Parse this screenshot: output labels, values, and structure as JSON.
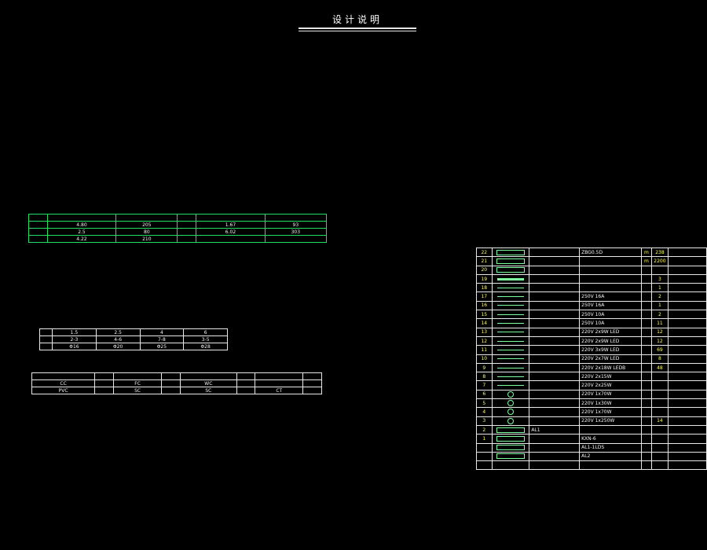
{
  "title": "设计说明",
  "left_column": [
    {
      "t": "",
      "s": "hd"
    },
    {
      "t": "",
      "s": ""
    },
    {
      "t": "",
      "s": ""
    },
    {
      "t": "",
      "s": "hd"
    },
    {
      "t": "",
      "s": ""
    },
    {
      "t": "",
      "s": ""
    },
    {
      "t": "",
      "s": ""
    },
    {
      "t": "",
      "s": ""
    },
    {
      "t": "",
      "s": "hd"
    },
    {
      "t": "",
      "s": ""
    },
    {
      "t": "",
      "s": ""
    },
    {
      "t": "",
      "s": ""
    },
    {
      "t": "",
      "s": ""
    },
    {
      "t": "",
      "s": ""
    },
    {
      "t": "",
      "s": ""
    },
    {
      "t": "",
      "s": "g"
    },
    {
      "t": "",
      "s": ""
    },
    {
      "t": "",
      "s": ""
    },
    {
      "t": "",
      "s": ""
    },
    {
      "t": "",
      "s": ""
    },
    {
      "t": "",
      "s": ""
    },
    {
      "t": "",
      "s": ""
    },
    {
      "t": "",
      "s": ""
    },
    {
      "t": "",
      "s": ""
    },
    {
      "t": "",
      "s": ""
    }
  ],
  "left_column_b": [
    {
      "t": "",
      "s": ""
    },
    {
      "t": "",
      "s": ""
    },
    {
      "t": "",
      "s": ""
    },
    {
      "t": "",
      "s": ""
    },
    {
      "t": "",
      "s": ""
    },
    {
      "t": "",
      "s": ""
    },
    {
      "t": "",
      "s": ""
    },
    {
      "t": "",
      "s": ""
    },
    {
      "t": "",
      "s": ""
    },
    {
      "t": "",
      "s": ""
    }
  ],
  "left_column_c": [
    {
      "t": "",
      "s": "g"
    },
    {
      "t": "",
      "s": ""
    }
  ],
  "left_column_d": [
    {
      "t": "",
      "s": ""
    },
    {
      "t": "",
      "s": ""
    },
    {
      "t": "",
      "s": ""
    },
    {
      "t": "",
      "s": ""
    },
    {
      "t": "",
      "s": ""
    },
    {
      "t": "",
      "s": "hd"
    },
    {
      "t": "",
      "s": ""
    },
    {
      "t": "",
      "s": ""
    },
    {
      "t": "",
      "s": ""
    },
    {
      "t": "",
      "s": ""
    },
    {
      "t": "",
      "s": ""
    },
    {
      "t": "",
      "s": ""
    },
    {
      "t": "",
      "s": ""
    },
    {
      "t": "",
      "s": ""
    },
    {
      "t": "",
      "s": ""
    }
  ],
  "right_column": [
    {
      "t": "",
      "s": ""
    },
    {
      "t": "",
      "s": ""
    },
    {
      "t": "",
      "s": ""
    },
    {
      "t": "",
      "s": ""
    },
    {
      "t": "",
      "s": ""
    },
    {
      "t": "",
      "s": ""
    },
    {
      "t": "",
      "s": ""
    },
    {
      "t": "",
      "s": ""
    },
    {
      "t": "",
      "s": ""
    },
    {
      "t": "",
      "s": ""
    },
    {
      "t": "",
      "s": ""
    },
    {
      "t": "",
      "s": ""
    },
    {
      "t": "",
      "s": ""
    },
    {
      "t": "",
      "s": ""
    },
    {
      "t": "",
      "s": ""
    },
    {
      "t": "",
      "s": ""
    },
    {
      "t": "",
      "s": ""
    },
    {
      "t": "",
      "s": ""
    },
    {
      "t": "",
      "s": ""
    },
    {
      "t": "",
      "s": ""
    },
    {
      "t": "",
      "s": ""
    },
    {
      "t": "",
      "s": ""
    },
    {
      "t": "",
      "s": ""
    },
    {
      "t": "",
      "s": ""
    },
    {
      "t": "",
      "s": ""
    },
    {
      "t": "",
      "s": ""
    },
    {
      "t": "",
      "s": ""
    },
    {
      "t": "",
      "s": ""
    },
    {
      "t": "",
      "s": ""
    }
  ],
  "illum_table": {
    "headers": [
      "",
      "",
      "",
      "",
      "",
      ""
    ],
    "rows": [
      [
        "",
        "4.80",
        "205",
        "",
        "1.67",
        "93"
      ],
      [
        "",
        "2.5",
        "80",
        "",
        "6.02",
        "303"
      ],
      [
        "",
        "4.22",
        "210",
        "",
        "",
        ""
      ]
    ]
  },
  "pipe_table": {
    "rows": [
      [
        "",
        "1.5",
        "2.5",
        "4",
        "6"
      ],
      [
        "",
        "2-3",
        "4-6",
        "7-8",
        "3-5"
      ],
      [
        "",
        "Φ16",
        "Φ20",
        "Φ25",
        "Φ28"
      ]
    ]
  },
  "code_table": {
    "rows": [
      [
        "",
        "",
        "",
        "",
        "",
        "",
        "",
        ""
      ],
      [
        "CC",
        "",
        "FC",
        "",
        "WC",
        "",
        "",
        ""
      ],
      [
        "PVC",
        "",
        "SC",
        "",
        "SC",
        "",
        "CT",
        ""
      ]
    ]
  },
  "legend": {
    "title": "",
    "header": {
      "num": "",
      "sym": "",
      "name": "",
      "spec": "",
      "unit": "",
      "qty": "",
      "remark": ""
    },
    "rows": [
      {
        "num": "22",
        "sym": "box",
        "name": "",
        "spec": "ZBG0.5D",
        "unit": "m",
        "qty": "238",
        "remark": ""
      },
      {
        "num": "21",
        "sym": "box",
        "name": "",
        "spec": "",
        "unit": "m",
        "qty": "2200",
        "remark": ""
      },
      {
        "num": "20",
        "sym": "box",
        "name": "",
        "spec": "",
        "unit": "",
        "qty": "",
        "remark": ""
      },
      {
        "num": "19",
        "sym": "bar",
        "name": "",
        "spec": "",
        "unit": "",
        "qty": "3",
        "remark": ""
      },
      {
        "num": "18",
        "sym": "line",
        "name": "",
        "spec": "",
        "unit": "",
        "qty": "1",
        "remark": ""
      },
      {
        "num": "17",
        "sym": "line",
        "name": "",
        "spec": "250V 16A",
        "unit": "",
        "qty": "2",
        "remark": ""
      },
      {
        "num": "16",
        "sym": "line",
        "name": "",
        "spec": "250V 16A",
        "unit": "",
        "qty": "1",
        "remark": ""
      },
      {
        "num": "15",
        "sym": "line",
        "name": "",
        "spec": "250V 10A",
        "unit": "",
        "qty": "2",
        "remark": ""
      },
      {
        "num": "14",
        "sym": "line",
        "name": "",
        "spec": "250V 10A",
        "unit": "",
        "qty": "11",
        "remark": ""
      },
      {
        "num": "13",
        "sym": "line",
        "name": "",
        "spec": "220V 2x9W LED",
        "unit": "",
        "qty": "12",
        "remark": ""
      },
      {
        "num": "12",
        "sym": "line",
        "name": "",
        "spec": "220V 2x9W LED",
        "unit": "",
        "qty": "12",
        "remark": ""
      },
      {
        "num": "11",
        "sym": "line",
        "name": "",
        "spec": "220V 3x9W LED",
        "unit": "",
        "qty": "69",
        "remark": ""
      },
      {
        "num": "10",
        "sym": "line",
        "name": "",
        "spec": "220V 2x7W LED",
        "unit": "",
        "qty": "8",
        "remark": ""
      },
      {
        "num": "9",
        "sym": "line",
        "name": "",
        "spec": "220V 2x18W LEDB",
        "unit": "",
        "qty": "48",
        "remark": ""
      },
      {
        "num": "8",
        "sym": "line",
        "name": "",
        "spec": "220V 2x15W",
        "unit": "",
        "qty": "",
        "remark": ""
      },
      {
        "num": "7",
        "sym": "line",
        "name": "",
        "spec": "220V 2x25W",
        "unit": "",
        "qty": "",
        "remark": ""
      },
      {
        "num": "6",
        "sym": "circ",
        "name": "",
        "spec": "220V 1x70W",
        "unit": "",
        "qty": "",
        "remark": ""
      },
      {
        "num": "5",
        "sym": "circ",
        "name": "",
        "spec": "220V 1x30W",
        "unit": "",
        "qty": "",
        "remark": ""
      },
      {
        "num": "4",
        "sym": "circ",
        "name": "",
        "spec": "220V 1x70W",
        "unit": "",
        "qty": "",
        "remark": ""
      },
      {
        "num": "3",
        "sym": "circ",
        "name": "",
        "spec": "220V 1x250W",
        "unit": "",
        "qty": "14",
        "remark": ""
      },
      {
        "num": "2",
        "sym": "box",
        "name": "AL1",
        "spec": "",
        "unit": "",
        "qty": "",
        "remark": ""
      },
      {
        "num": "1",
        "sym": "box",
        "name": "",
        "spec": "KXN-6",
        "unit": "",
        "qty": "",
        "remark": ""
      },
      {
        "num": "",
        "sym": "box",
        "name": "",
        "spec": "AL1-1LDS",
        "unit": "",
        "qty": "",
        "remark": ""
      },
      {
        "num": "",
        "sym": "box",
        "name": "",
        "spec": "AL2",
        "unit": "",
        "qty": "",
        "remark": ""
      }
    ]
  }
}
